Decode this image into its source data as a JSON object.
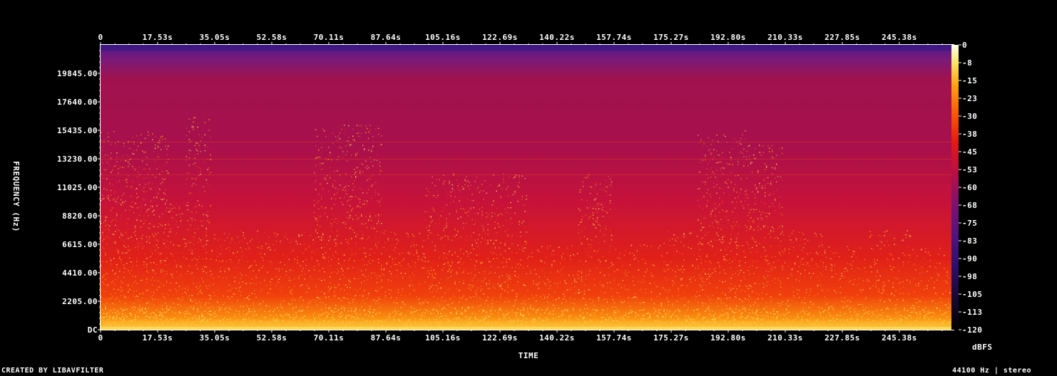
{
  "chart_data": {
    "type": "heatmap",
    "xlabel": "TIME",
    "ylabel": "FREQUENCY (Hz)",
    "x_ticks": [
      "0",
      "17.53s",
      "35.05s",
      "52.58s",
      "70.11s",
      "87.64s",
      "105.16s",
      "122.69s",
      "140.22s",
      "157.74s",
      "175.27s",
      "192.80s",
      "210.33s",
      "227.85s",
      "245.38s"
    ],
    "y_ticks": [
      "DC",
      "2205.00",
      "4410.00",
      "6615.00",
      "8820.00",
      "11025.00",
      "13230.00",
      "15435.00",
      "17640.00",
      "19845.00"
    ],
    "colorbar": {
      "label": "dBFS",
      "ticks": [
        "0",
        "-8",
        "-15",
        "-23",
        "-30",
        "-38",
        "-45",
        "-53",
        "-60",
        "-68",
        "-75",
        "-83",
        "-90",
        "-98",
        "-105",
        "-113",
        "-120"
      ],
      "range": [
        -120,
        0
      ]
    },
    "x_range_s": [
      0,
      262.9
    ],
    "y_range_hz": [
      0,
      22050
    ]
  },
  "footer": {
    "left": "CREATED BY LIBAVFILTER",
    "right": "44100 Hz | stereo"
  }
}
